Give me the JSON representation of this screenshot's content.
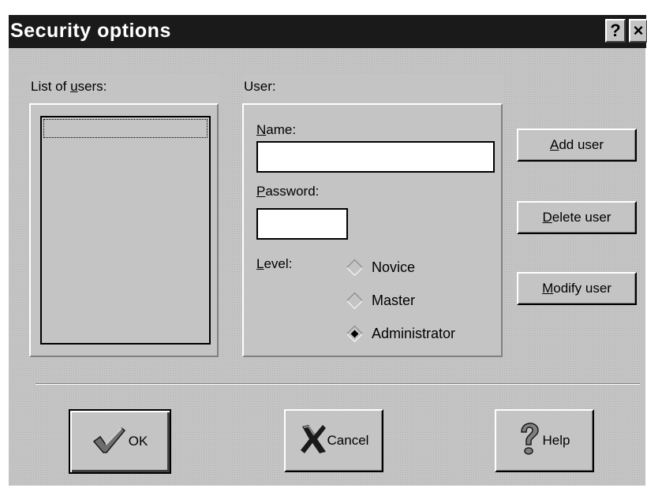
{
  "window": {
    "title": "Security options",
    "help_button": "?",
    "close_button": "×"
  },
  "users_panel": {
    "label_prefix": "List of ",
    "label_hotkey": "u",
    "label_suffix": "sers:",
    "users": []
  },
  "user_panel": {
    "label": "User:",
    "name_label_hotkey": "N",
    "name_label_rest": "ame:",
    "name_value": "",
    "password_label_hotkey": "P",
    "password_label_rest": "assword:",
    "password_value": "",
    "level_label_hotkey": "L",
    "level_label_rest": "evel:",
    "levels": [
      {
        "label": "Novice",
        "selected": false
      },
      {
        "label": "Master",
        "selected": false
      },
      {
        "label": "Administrator",
        "selected": true
      }
    ]
  },
  "actions": {
    "add_hotkey": "A",
    "add_rest": "dd user",
    "delete_hotkey": "D",
    "delete_rest": "elete user",
    "modify_hotkey": "M",
    "modify_rest": "odify user"
  },
  "footer": {
    "ok_label": "OK",
    "cancel_label": "Cancel",
    "help_label": "Help",
    "ok_icon": "checkmark-icon",
    "cancel_icon": "x-mark-icon",
    "help_icon": "question-mark-icon"
  }
}
